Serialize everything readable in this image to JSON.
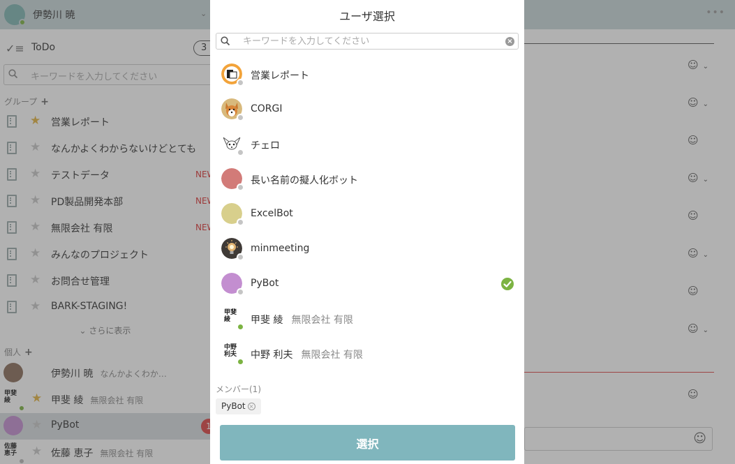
{
  "app": {
    "current_user": "伊勢川 暁",
    "todo": {
      "label": "ToDo",
      "count": "3"
    },
    "search_placeholder": "キーワードを入力してください",
    "groups_title": "グループ",
    "groups": [
      {
        "name": "営業レポート",
        "starred": true,
        "badge": ""
      },
      {
        "name": "なんかよくわからないけどとても",
        "starred": false,
        "badge": ""
      },
      {
        "name": "テストデータ",
        "starred": false,
        "badge": "NEW"
      },
      {
        "name": "PD製品開発本部",
        "starred": false,
        "badge": "NEW"
      },
      {
        "name": "無限会社 有限",
        "starred": false,
        "badge": "NEW"
      },
      {
        "name": "みんなのプロジェクト",
        "starred": false,
        "badge": ""
      },
      {
        "name": "お問合せ管理",
        "starred": false,
        "badge": ""
      },
      {
        "name": "BARK-STAGING!",
        "starred": false,
        "badge": ""
      }
    ],
    "show_more": "さらに表示",
    "personal_title": "個人",
    "people": [
      {
        "name": "伊勢川 暁",
        "company": "なんかよくわか…",
        "avatar_text": "",
        "starred": false,
        "badge": ""
      },
      {
        "name": "甲斐 綾",
        "company": "無限会社 有限",
        "avatar_text": "甲斐 綾",
        "starred": true,
        "badge": ""
      },
      {
        "name": "PyBot",
        "company": "",
        "avatar_text": "",
        "starred": false,
        "badge": "1"
      },
      {
        "name": "佐藤 恵子",
        "company": "無限会社 有限",
        "avatar_text": "佐藤 恵子",
        "starred": false,
        "badge": ""
      }
    ]
  },
  "modal": {
    "title": "ユーザ選択",
    "search_placeholder": "キーワードを入力してください",
    "users": [
      {
        "name": "営業レポート",
        "company": "",
        "avatar": "report-icon",
        "avatar_color": "#f2a33a",
        "online": false,
        "selected": false
      },
      {
        "name": "CORGI",
        "company": "",
        "avatar": "corgi-icon",
        "avatar_color": "#d8b97c",
        "online": false,
        "selected": false
      },
      {
        "name": "チェロ",
        "company": "",
        "avatar": "chihuahua-icon",
        "avatar_color": "#ffffff",
        "online": false,
        "selected": false
      },
      {
        "name": "長い名前の擬人化ボット",
        "company": "",
        "avatar": "circle",
        "avatar_color": "#d27b78",
        "online": false,
        "selected": false
      },
      {
        "name": "ExcelBot",
        "company": "",
        "avatar": "circle",
        "avatar_color": "#d8cf8c",
        "online": false,
        "selected": false
      },
      {
        "name": "minmeeting",
        "company": "",
        "avatar": "lightbulb-icon",
        "avatar_color": "#3f3a36",
        "online": false,
        "selected": false
      },
      {
        "name": "PyBot",
        "company": "",
        "avatar": "circle",
        "avatar_color": "#c38ed0",
        "online": false,
        "selected": true
      },
      {
        "name": "甲斐 綾",
        "company": "無限会社 有限",
        "avatar_text": "甲斐 綾",
        "online": true,
        "selected": false
      },
      {
        "name": "中野 利夫",
        "company": "無限会社 有限",
        "avatar_text": "中野 利夫",
        "online": true,
        "selected": false
      }
    ],
    "members_label": "メンバー(1)",
    "members": [
      "PyBot"
    ],
    "select_button": "選択"
  }
}
